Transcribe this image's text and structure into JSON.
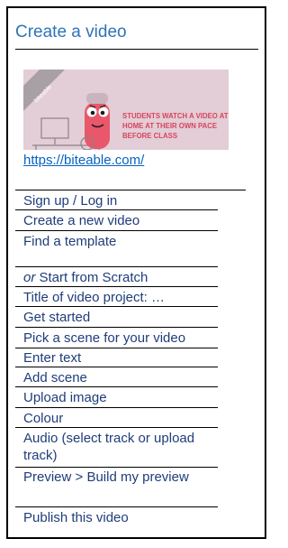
{
  "title": "Create a video",
  "thumbnail": {
    "headline_lines": [
      "STUDENTS WATCH A VIDEO AT",
      "HOME AT THEIR OWN PACE",
      "BEFORE CLASS"
    ],
    "ribbon_text": "biteable"
  },
  "link": "https://biteable.com/",
  "steps": {
    "signup": "Sign up / Log in",
    "create": "Create a new video",
    "template": "Find a template",
    "scratch_or": "or",
    "scratch_rest": " Start from Scratch",
    "title_project": "Title of video project: …",
    "get_started": "Get started",
    "pick_scene": "Pick a scene for your video",
    "enter_text": "Enter text",
    "add_scene": "Add scene",
    "upload_image": "Upload image",
    "colour": "Colour",
    "audio": "Audio (select track or upload track)",
    "preview": "Preview > Build my preview",
    "publish": "Publish this video"
  },
  "colors": {
    "heading": "#2e74b5",
    "step_text": "#1f3d7a",
    "link": "#0563c1",
    "thumbnail_bg": "#e3cdd6",
    "thumbnail_accent": "#e8576a"
  }
}
